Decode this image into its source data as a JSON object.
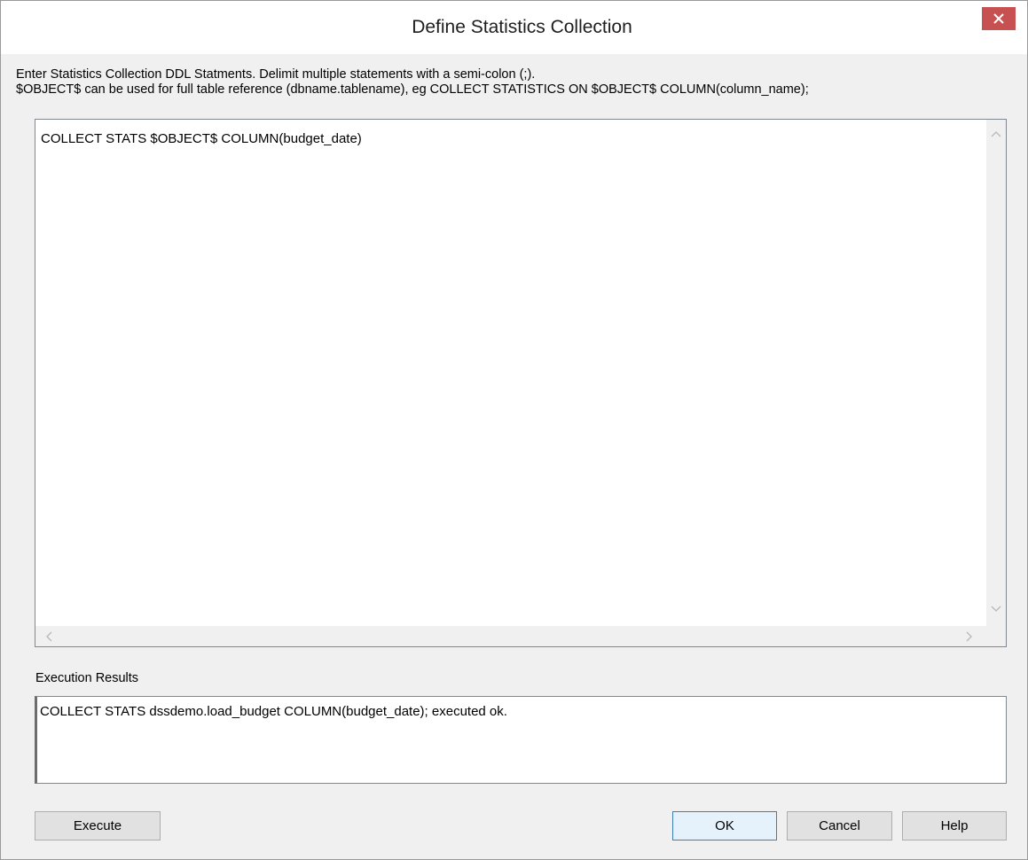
{
  "window": {
    "title": "Define Statistics Collection",
    "close_icon": "close-icon",
    "close_color": "#c75050"
  },
  "instructions": {
    "line1": "Enter Statistics Collection DDL Statments. Delimit multiple statements with a semi-colon (;).",
    "line2": "$OBJECT$ can be used for full table reference (dbname.tablename), eg COLLECT STATISTICS ON $OBJECT$ COLUMN(column_name);"
  },
  "ddl_editor": {
    "value": "COLLECT STATS $OBJECT$ COLUMN(budget_date)"
  },
  "results": {
    "label": "Execution Results",
    "value": "COLLECT STATS dssdemo.load_budget COLUMN(budget_date); executed ok."
  },
  "buttons": {
    "execute": "Execute",
    "ok": "OK",
    "cancel": "Cancel",
    "help": "Help"
  }
}
